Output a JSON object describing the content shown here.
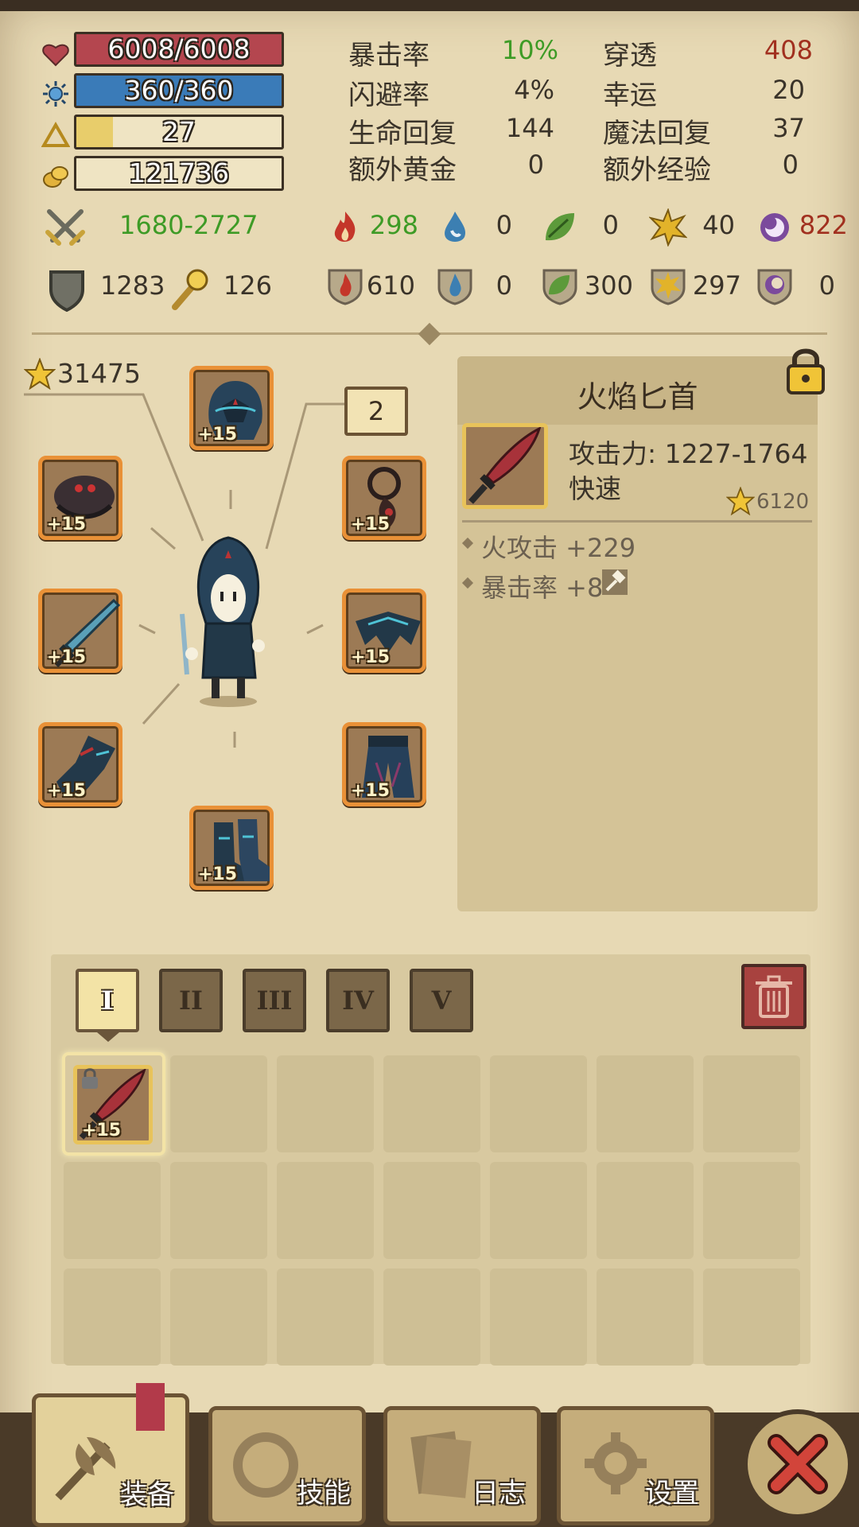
{
  "resources": {
    "hp": "6008/6008",
    "mp": "360/360",
    "level": "27",
    "gold": "121736",
    "level_progress": 0.18
  },
  "stats": [
    {
      "label": "暴击率",
      "value": "10%",
      "color": "#3e9b26"
    },
    {
      "label": "穿透",
      "value": "408",
      "color": "#a1301f"
    },
    {
      "label": "闪避率",
      "value": "4%",
      "color": "#3a3329"
    },
    {
      "label": "幸运",
      "value": "20",
      "color": "#3a3329"
    },
    {
      "label": "生命回复",
      "value": "144",
      "color": "#3a3329"
    },
    {
      "label": "魔法回复",
      "value": "37",
      "color": "#3a3329"
    },
    {
      "label": "额外黄金",
      "value": "0",
      "color": "#3a3329"
    },
    {
      "label": "额外经验",
      "value": "0",
      "color": "#3a3329"
    }
  ],
  "attack": {
    "range": "1680-2727",
    "fire": "298",
    "water": "0",
    "nature": "0",
    "lightning": "40",
    "arcane": "822"
  },
  "defense": {
    "armor": "1283",
    "magic": "126",
    "fire": "610",
    "water": "0",
    "nature": "300",
    "lightning": "297",
    "arcane": "0"
  },
  "equipment": {
    "gear_score": "31475",
    "set_count": "2",
    "slots": [
      {
        "name": "helmet",
        "level": "+15"
      },
      {
        "name": "shoulders",
        "level": "+15"
      },
      {
        "name": "amulet",
        "level": "+15"
      },
      {
        "name": "weapon",
        "level": "+15"
      },
      {
        "name": "cloak",
        "level": "+15"
      },
      {
        "name": "gloves",
        "level": "+15"
      },
      {
        "name": "pants",
        "level": "+15"
      },
      {
        "name": "boots",
        "level": "+15"
      }
    ]
  },
  "item_detail": {
    "name": "火焰匕首",
    "attack": "攻击力: 1227-1764",
    "speed": "快速",
    "score": "6120",
    "bonuses": [
      "火攻击 +229",
      "暴击率 +8"
    ]
  },
  "inventory": {
    "tabs": [
      "I",
      "II",
      "III",
      "IV",
      "V"
    ],
    "active_tab": "I",
    "items": [
      {
        "name": "fire-dagger",
        "level": "+15",
        "locked": true
      }
    ]
  },
  "nav": {
    "equipment": "装备",
    "skills": "技能",
    "log": "日志",
    "settings": "设置"
  },
  "colors": {
    "hp": "#b4464f",
    "mp": "#3a7bb8",
    "xp": "#e8cd6b",
    "positive": "#3e9b26",
    "negative": "#a1301f",
    "slot_border": "#e99137"
  }
}
